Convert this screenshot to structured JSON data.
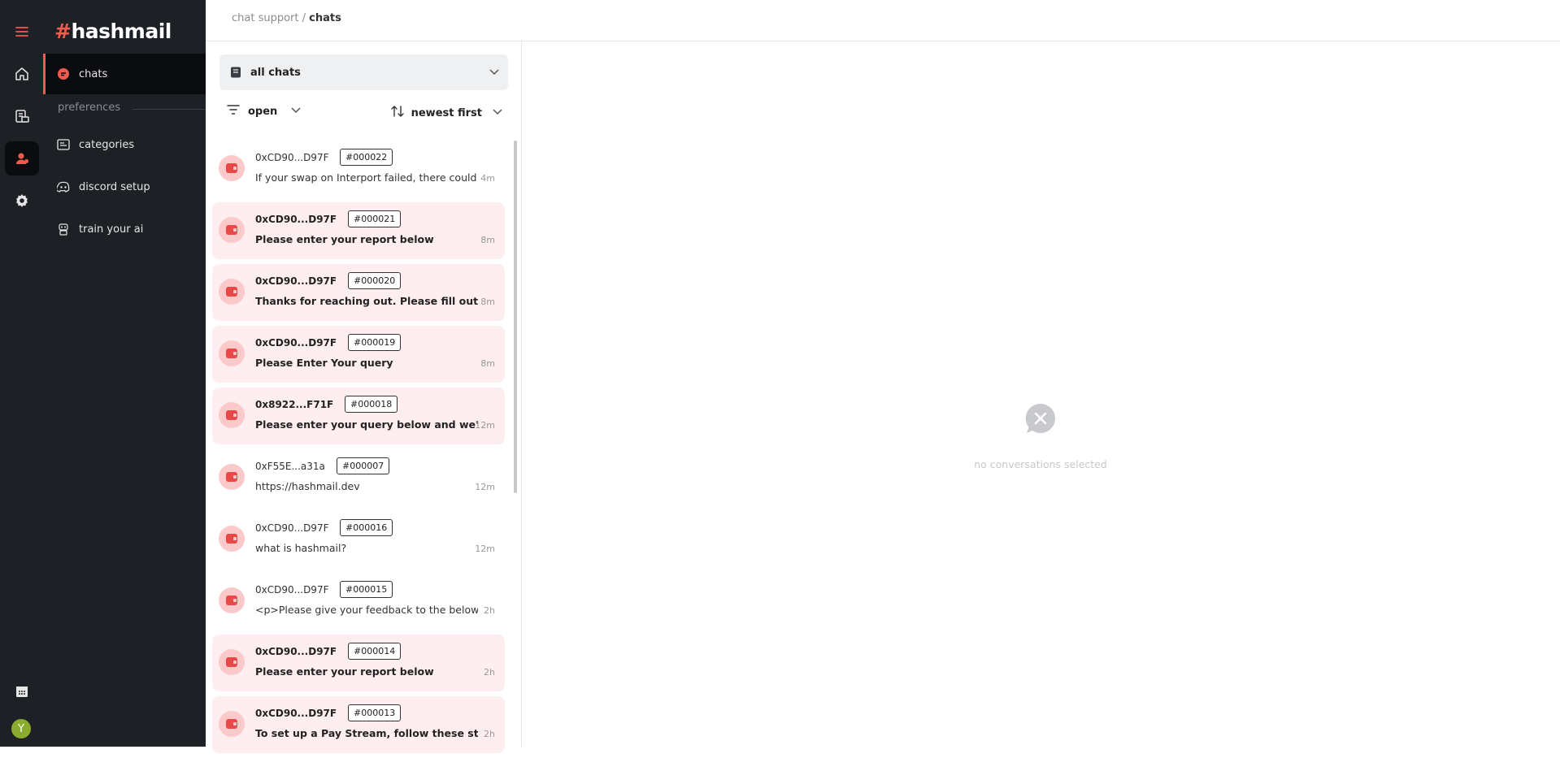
{
  "brand": {
    "logo_hash": "#",
    "logo_text": "hashmail",
    "accent": "#ee5c4e"
  },
  "rail": {
    "items": [
      {
        "icon": "menu-icon"
      },
      {
        "icon": "home-icon"
      },
      {
        "icon": "mail-list-icon"
      },
      {
        "icon": "support-agent-icon",
        "active": true
      },
      {
        "icon": "gear-icon"
      },
      {
        "icon": "calendar-icon"
      }
    ],
    "avatar_initial": "Y"
  },
  "nav": {
    "active_item": {
      "label": "chats",
      "icon": "chat-bubble-icon"
    },
    "section_label": "preferences",
    "items": [
      {
        "label": "categories",
        "icon": "categories-icon"
      },
      {
        "label": "discord setup",
        "icon": "discord-icon"
      },
      {
        "label": "train your ai",
        "icon": "robot-icon"
      }
    ]
  },
  "breadcrumb": {
    "parent": "chat support",
    "separator": " / ",
    "current": "chats"
  },
  "list": {
    "chat_filter": "all chats",
    "status_filter": "open",
    "sort": "newest first",
    "chats": [
      {
        "address": "0xCD90...D97F",
        "id": "#000022",
        "message": "If your swap on Interport failed, there could be",
        "time": "4m",
        "unread": false
      },
      {
        "address": "0xCD90...D97F",
        "id": "#000021",
        "message": "Please enter your report below",
        "time": "8m",
        "unread": true
      },
      {
        "address": "0xCD90...D97F",
        "id": "#000020",
        "message": "Thanks for reaching out. Please fill out this po",
        "time": "8m",
        "unread": true
      },
      {
        "address": "0xCD90...D97F",
        "id": "#000019",
        "message": "Please Enter Your query",
        "time": "8m",
        "unread": true
      },
      {
        "address": "0x8922...F71F",
        "id": "#000018",
        "message": "Please enter your query below and we'll get b",
        "time": "12m",
        "unread": true
      },
      {
        "address": "0xF55E...a31a",
        "id": "#000007",
        "message": "https://hashmail.dev",
        "time": "12m",
        "unread": false
      },
      {
        "address": "0xCD90...D97F",
        "id": "#000016",
        "message": "what is hashmail?",
        "time": "12m",
        "unread": false
      },
      {
        "address": "0xCD90...D97F",
        "id": "#000015",
        "message": "<p>Please give your feedback to the below link",
        "time": "2h",
        "unread": false
      },
      {
        "address": "0xCD90...D97F",
        "id": "#000014",
        "message": "Please enter your report below",
        "time": "2h",
        "unread": true
      },
      {
        "address": "0xCD90...D97F",
        "id": "#000013",
        "message": "To set up a Pay Stream, follow these steps:",
        "time": "2h",
        "unread": true
      }
    ]
  },
  "empty_state": {
    "icon": "chat-closed-icon",
    "text": "no conversations selected"
  }
}
